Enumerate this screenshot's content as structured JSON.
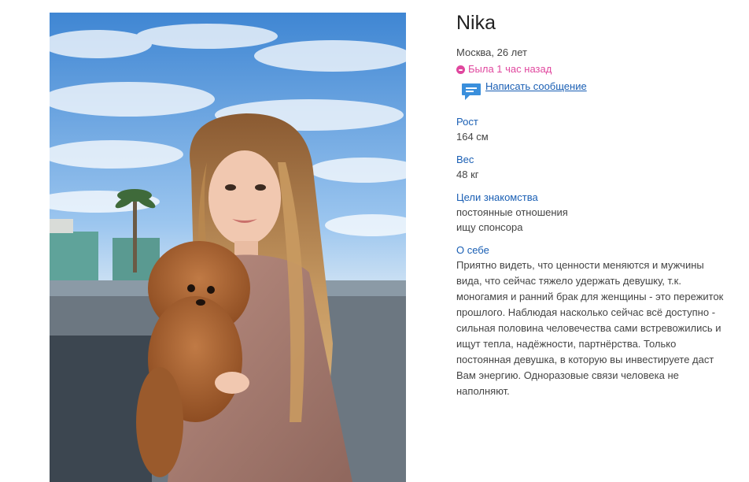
{
  "profile": {
    "name": "Nika",
    "city_age": "Москва, 26 лет",
    "online_status": "Была 1 час назад",
    "message_link": "Написать сообщение",
    "accent_color": "#1a5fb4",
    "status_color": "#e0479e",
    "fields": [
      {
        "label": "Рост",
        "values": [
          "164 см"
        ]
      },
      {
        "label": "Вес",
        "values": [
          "48 кг"
        ]
      },
      {
        "label": "Цели знакомства",
        "values": [
          "постоянные отношения",
          "ищу спонсора"
        ]
      }
    ],
    "about": {
      "label": "О себе",
      "text": "Приятно видеть, что ценности меняются и мужчины вида, что сейчас тяжело удержать девушку, т.к. моногамия и ранний брак для женщины - это пережиток прошлого. Наблюдая насколько сейчас всё доступно - сильная половина человечества сами встревожились и ищут тепла, надёжности, партнёрства. Только постоянная девушка, в которую вы инвестируете даст Вам энергию. Одноразовые связи человека не наполняют."
    }
  },
  "icons": {
    "online": "status-dot-icon",
    "message": "chat-bubble-icon"
  }
}
